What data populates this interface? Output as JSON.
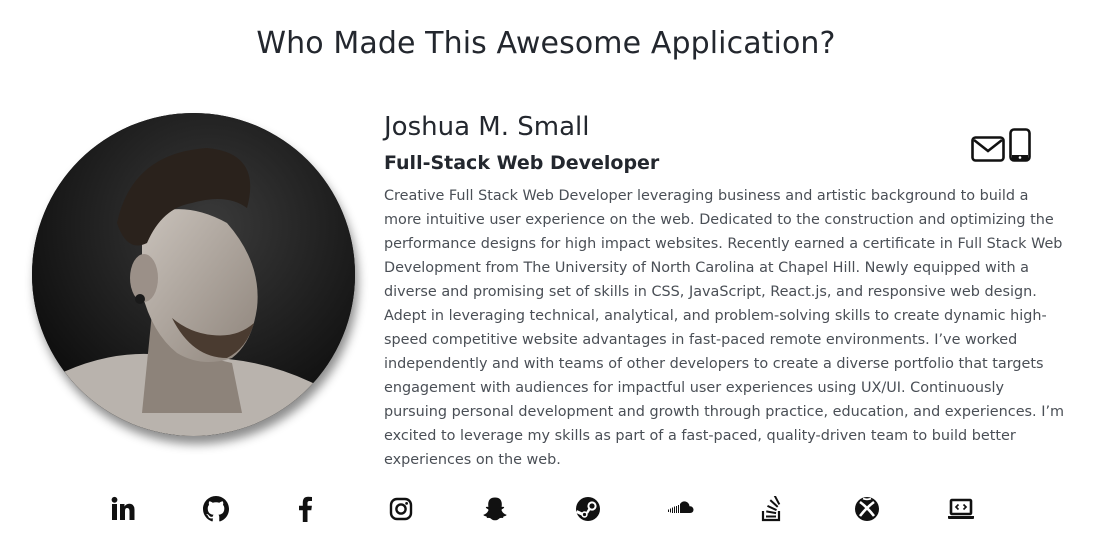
{
  "header": {
    "title": "Who Made This Awesome Application?"
  },
  "profile": {
    "name": "Joshua M. Small",
    "role": "Full-Stack Web Developer",
    "bio": "Creative Full Stack Web Developer leveraging business and artistic background to build a more intuitive user experience on the web. Dedicated to the construction and optimizing the performance designs for high impact websites. Recently earned a certificate in Full Stack Web Development from The University of North Carolina at Chapel Hill. Newly equipped with a diverse and promising set of skills in CSS, JavaScript, React.js, and responsive web design. Adept in leveraging technical, analytical, and problem-solving skills to create dynamic high-speed competitive website advantages in fast-paced remote environments. I’ve worked independently and with teams of other developers to create a diverse portfolio that targets engagement with audiences for impactful user experiences using UX/UI. Continuously pursuing personal development and growth through practice, education, and experiences. I’m excited to leverage my skills as part of a fast-paced, quality-driven team to build better experiences on the web."
  },
  "contact": {
    "icons": [
      "envelope-icon",
      "phone-icon"
    ]
  },
  "social": {
    "icons": [
      "linkedin-icon",
      "github-icon",
      "facebook-icon",
      "instagram-icon",
      "snapchat-icon",
      "steam-icon",
      "soundcloud-icon",
      "stackoverflow-icon",
      "xbox-icon",
      "laptop-code-icon"
    ]
  },
  "colors": {
    "text": "#23272e",
    "body_text": "#4a4f56",
    "icon": "#111111"
  }
}
